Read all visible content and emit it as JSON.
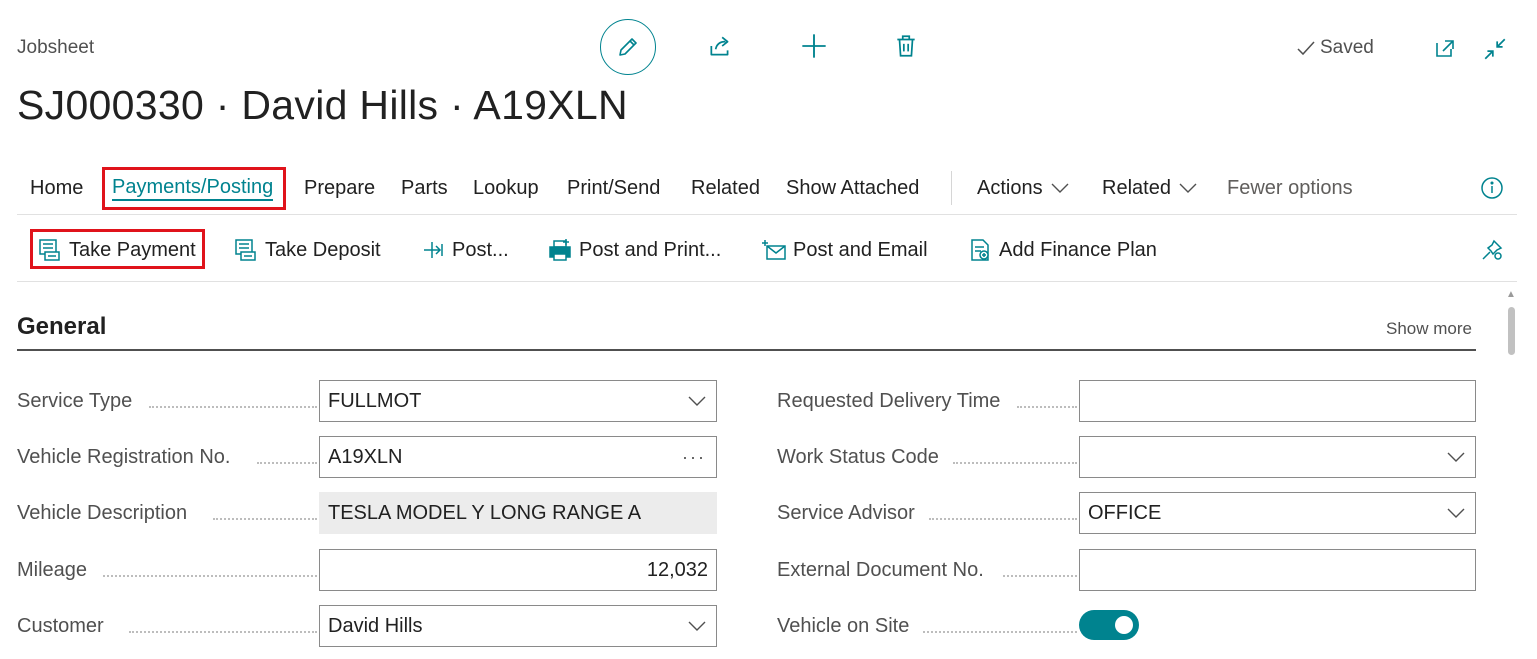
{
  "header": {
    "page_kind": "Jobsheet",
    "title": "SJ000330 · David Hills · A19XLN",
    "saved_label": "Saved"
  },
  "menu": {
    "items": [
      "Home",
      "Payments/Posting",
      "Prepare",
      "Parts",
      "Lookup",
      "Print/Send",
      "Related",
      "Show Attached"
    ],
    "active": "Payments/Posting",
    "dropdowns": [
      "Actions",
      "Related"
    ],
    "fewer_options": "Fewer options"
  },
  "actions": {
    "take_payment": "Take Payment",
    "take_deposit": "Take Deposit",
    "post": "Post...",
    "post_and_print": "Post and Print...",
    "post_and_email": "Post and Email",
    "add_finance_plan": "Add Finance Plan"
  },
  "section": {
    "title": "General",
    "show_more": "Show more"
  },
  "fields_left": [
    {
      "label": "Service Type",
      "value": "FULLMOT",
      "kind": "dropdown"
    },
    {
      "label": "Vehicle Registration No.",
      "value": "A19XLN",
      "kind": "lookup"
    },
    {
      "label": "Vehicle Description",
      "value": "TESLA MODEL Y LONG RANGE A",
      "kind": "readonly"
    },
    {
      "label": "Mileage",
      "value": "12,032",
      "kind": "number"
    },
    {
      "label": "Customer",
      "value": "David Hills",
      "kind": "dropdown"
    }
  ],
  "fields_right": [
    {
      "label": "Requested Delivery Time",
      "value": "",
      "kind": "text"
    },
    {
      "label": "Work Status Code",
      "value": "",
      "kind": "dropdown"
    },
    {
      "label": "Service Advisor",
      "value": "OFFICE",
      "kind": "dropdown"
    },
    {
      "label": "External Document No.",
      "value": "",
      "kind": "text"
    },
    {
      "label": "Vehicle on Site",
      "value": true,
      "kind": "toggle"
    }
  ],
  "icons": {
    "edit": "pencil-icon",
    "share": "share-icon",
    "new": "plus-icon",
    "delete": "trash-icon",
    "saved": "checkmark-icon",
    "open_new_window": "open-new-window-icon",
    "collapse": "collapse-icon",
    "info": "info-icon",
    "pin": "pin-icon"
  },
  "colors": {
    "accent": "#00838f",
    "highlight": "#e0131b",
    "text": "#212121",
    "label": "#505050"
  }
}
